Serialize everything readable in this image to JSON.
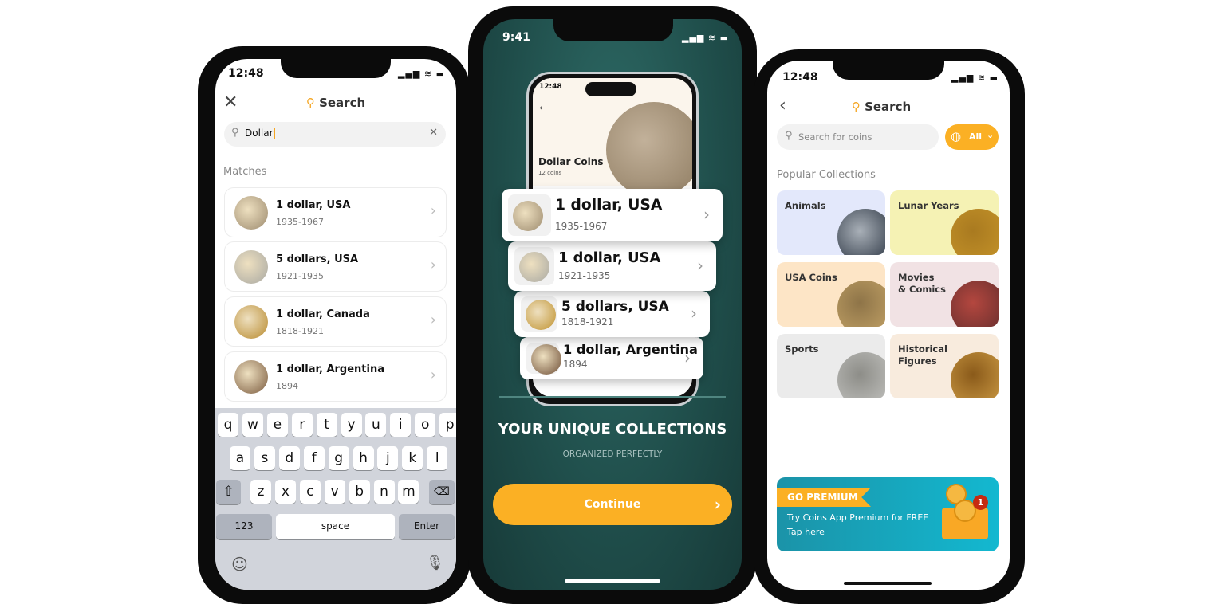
{
  "left": {
    "time": "12:48",
    "title": "Search",
    "search_value": "Dollar",
    "section": "Matches",
    "items": [
      {
        "name": "1 dollar, USA",
        "years": "1935-1967",
        "color": "#9c8a6e"
      },
      {
        "name": "5 dollars, USA",
        "years": "1921-1935",
        "color": "#a8a8a2"
      },
      {
        "name": "1 dollar, Canada",
        "years": "1818-1921",
        "color": "#b88a2e"
      },
      {
        "name": "1 dollar, Argentina",
        "years": "1894",
        "color": "#7a5a3e"
      }
    ],
    "keyboard": {
      "row1": [
        "q",
        "w",
        "e",
        "r",
        "t",
        "y",
        "u",
        "i",
        "o",
        "p"
      ],
      "row2": [
        "a",
        "s",
        "d",
        "f",
        "g",
        "h",
        "j",
        "k",
        "l"
      ],
      "row3": [
        "z",
        "x",
        "c",
        "v",
        "b",
        "n",
        "m"
      ],
      "numbers": "123",
      "space": "space",
      "enter": "Enter"
    }
  },
  "middle": {
    "time": "9:41",
    "inner": {
      "time": "12:48",
      "title": "Dollar Coins",
      "count": "12 coins"
    },
    "cards": [
      {
        "name": "1 dollar, USA",
        "years": "1935-1967",
        "color": "#9c8a6e"
      },
      {
        "name": "1 dollar, USA",
        "years": "1921-1935",
        "color": "#a8a8a2"
      },
      {
        "name": "5 dollars, USA",
        "years": "1818-1921",
        "color": "#c0922e"
      },
      {
        "name": "1 dollar, Argentina",
        "years": "1894",
        "color": "#6e4e36"
      }
    ],
    "headline": "YOUR UNIQUE COLLECTIONS",
    "subheadline": "ORGANIZED PERFECTLY",
    "continue": "Continue",
    "bg": "#1f4d4a",
    "accent": "#fbb024"
  },
  "right": {
    "time": "12:48",
    "title": "Search",
    "search_placeholder": "Search for coins",
    "filter": "All",
    "section": "Popular Collections",
    "tiles": [
      {
        "label": "Animals",
        "bg": "#e3e8fb"
      },
      {
        "label": "Lunar Years",
        "bg": "#f5f2b4"
      },
      {
        "label": "USA Coins",
        "bg": "#fde5c6"
      },
      {
        "label": "Movies\n& Comics",
        "bg": "#f1e2e4"
      },
      {
        "label": "Sports",
        "bg": "#ebebeb"
      },
      {
        "label": "Historical\nFigures",
        "bg": "#f8ebdd"
      }
    ],
    "premium": {
      "badge": "GO PREMIUM",
      "line1": "Try Coins App Premium for FREE",
      "line2": "Tap here",
      "notification_count": "1"
    }
  }
}
